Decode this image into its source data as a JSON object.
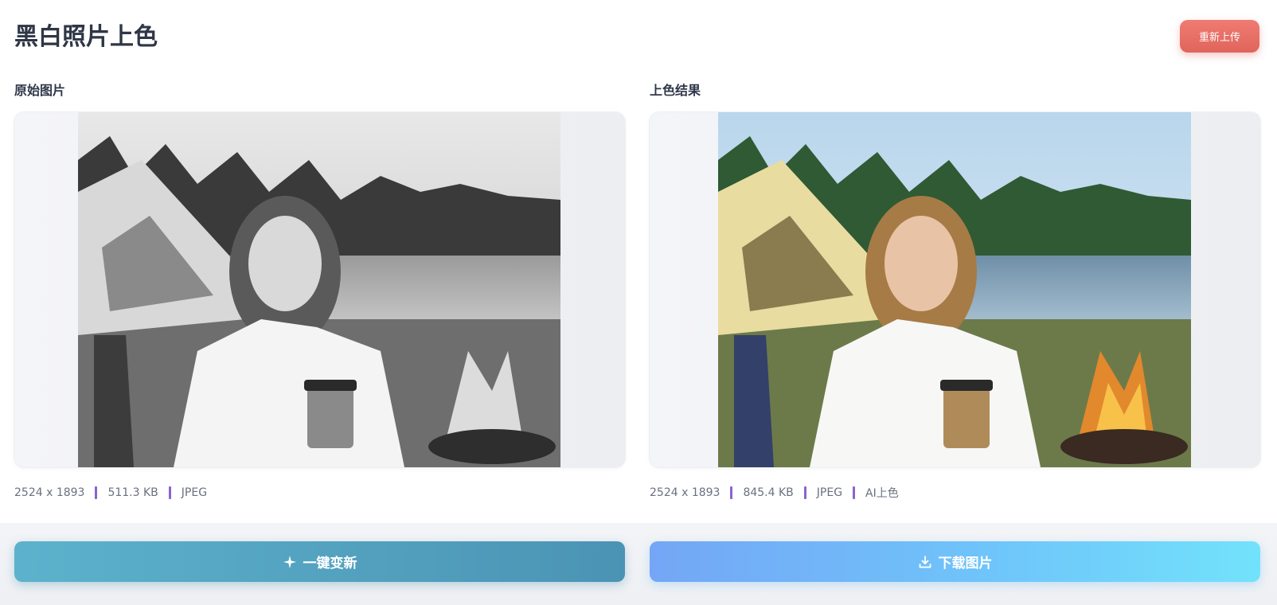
{
  "header": {
    "title": "黑白照片上色",
    "reupload_label": "重新上传"
  },
  "original": {
    "title": "原始图片",
    "meta": [
      "2524 x 1893",
      "511.3 KB",
      "JPEG"
    ]
  },
  "result": {
    "title": "上色结果",
    "meta": [
      "2524 x 1893",
      "845.4 KB",
      "JPEG",
      "AI上色"
    ]
  },
  "actions": {
    "renew_label": "一键变新",
    "download_label": "下载图片"
  },
  "colors": {
    "reupload": "#e6695f",
    "meta_separator": "#8a63d2",
    "renew_button": "#4f9bbb",
    "download_button": "#6fc4fa"
  },
  "icons": {
    "renew": "sparkle-icon",
    "download": "download-icon"
  }
}
